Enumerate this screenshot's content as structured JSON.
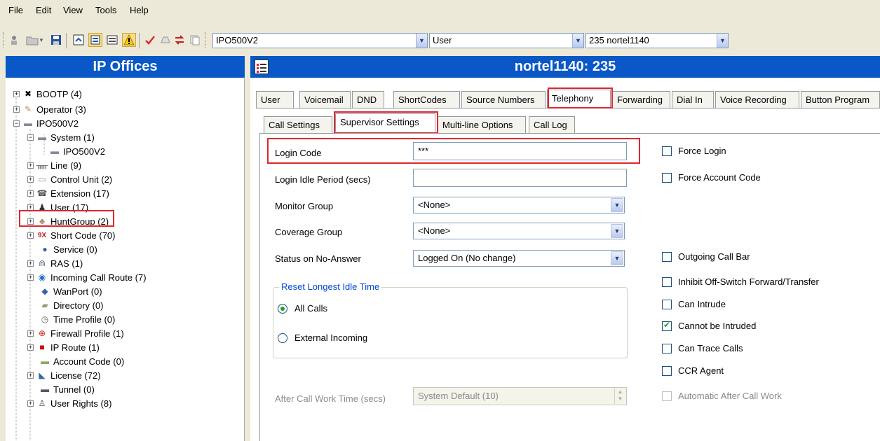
{
  "menu": [
    "File",
    "Edit",
    "View",
    "Tools",
    "Help"
  ],
  "toolbar": {
    "combo_system": "IPO500V2",
    "combo_type": "User",
    "combo_record": "235 nortel1140"
  },
  "left_panel": {
    "title": "IP Offices",
    "tree": [
      {
        "label": "BOOTP (4)",
        "icon": "bootp-icon"
      },
      {
        "label": "Operator (3)",
        "icon": "operator-icon"
      },
      {
        "label": "IPO500V2",
        "icon": "ipo-unit-icon"
      },
      {
        "label": "System (1)",
        "icon": "system-icon"
      },
      {
        "label": "IPO500V2",
        "icon": "ipo-unit-icon"
      },
      {
        "label": "Line (9)",
        "icon": "line-icon"
      },
      {
        "label": "Control Unit (2)",
        "icon": "control-unit-icon"
      },
      {
        "label": "Extension (17)",
        "icon": "extension-icon"
      },
      {
        "label": "User (17)",
        "icon": "user-icon"
      },
      {
        "label": "HuntGroup (2)",
        "icon": "huntgroup-icon"
      },
      {
        "label": "Short Code (70)",
        "icon": "shortcode-icon"
      },
      {
        "label": "Service (0)",
        "icon": "service-icon"
      },
      {
        "label": "RAS (1)",
        "icon": "ras-icon"
      },
      {
        "label": "Incoming Call Route (7)",
        "icon": "incoming-call-route-icon"
      },
      {
        "label": "WanPort (0)",
        "icon": "wanport-icon"
      },
      {
        "label": "Directory (0)",
        "icon": "directory-icon"
      },
      {
        "label": "Time Profile (0)",
        "icon": "time-profile-icon"
      },
      {
        "label": "Firewall Profile (1)",
        "icon": "firewall-icon"
      },
      {
        "label": "IP Route (1)",
        "icon": "ip-route-icon"
      },
      {
        "label": "Account Code (0)",
        "icon": "account-code-icon"
      },
      {
        "label": "License (72)",
        "icon": "license-icon"
      },
      {
        "label": "Tunnel (0)",
        "icon": "tunnel-icon"
      },
      {
        "label": "User Rights (8)",
        "icon": "user-rights-icon"
      }
    ]
  },
  "right_panel": {
    "title": "nortel1140: 235",
    "tabs": [
      "User",
      "Voicemail",
      "DND",
      "ShortCodes",
      "Source Numbers",
      "Telephony",
      "Forwarding",
      "Dial In",
      "Voice Recording",
      "Button Program"
    ],
    "subtabs": [
      "Call Settings",
      "Supervisor Settings",
      "Multi-line Options",
      "Call Log"
    ],
    "fields": {
      "login_code_label": "Login Code",
      "login_code_value": "***",
      "login_idle_label": "Login Idle Period (secs)",
      "login_idle_value": "",
      "monitor_group_label": "Monitor Group",
      "monitor_group_value": "<None>",
      "coverage_group_label": "Coverage Group",
      "coverage_group_value": "<None>",
      "status_no_answer_label": "Status on No-Answer",
      "status_no_answer_value": "Logged On (No change)",
      "reset_group_label": "Reset Longest Idle Time",
      "radio_all_calls": "All Calls",
      "radio_external": "External Incoming",
      "after_call_label": "After Call Work Time (secs)",
      "after_call_value": "System Default (10)"
    },
    "checkboxes": [
      {
        "label": "Force Login",
        "checked": false
      },
      {
        "label": "Force Account Code",
        "checked": false
      },
      {
        "label": "Outgoing Call Bar",
        "checked": false
      },
      {
        "label": "Inhibit Off-Switch Forward/Transfer",
        "checked": false
      },
      {
        "label": "Can Intrude",
        "checked": false
      },
      {
        "label": "Cannot be Intruded",
        "checked": true
      },
      {
        "label": "Can Trace Calls",
        "checked": false
      },
      {
        "label": "CCR Agent",
        "checked": false
      },
      {
        "label": "Automatic After Call Work",
        "checked": false
      }
    ]
  },
  "colors": {
    "header_blue": "#0a58c8",
    "highlight_red": "#e0262d",
    "check_green": "#21a121",
    "group_legend_blue": "#0046d5"
  }
}
